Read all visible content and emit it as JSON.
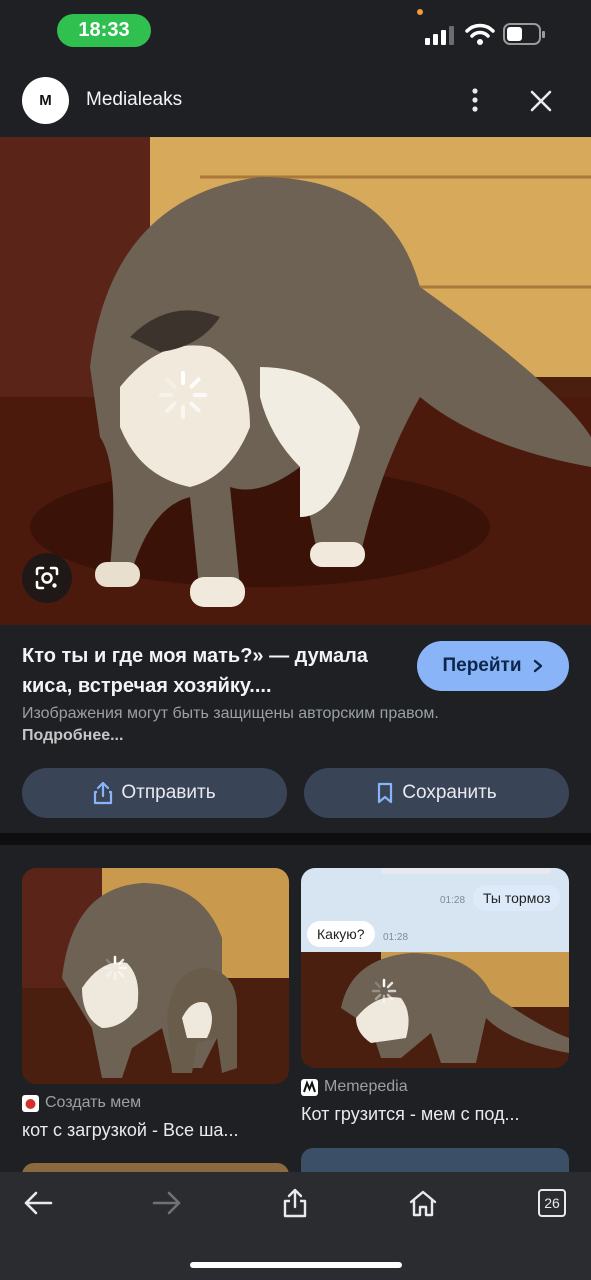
{
  "status": {
    "time": "18:33"
  },
  "header": {
    "logo_letter": "M",
    "site_name": "Medialeaks"
  },
  "result": {
    "title": "Кто ты и где моя мать?» — думала киса, встречая хозяйку....",
    "goto_label": "Перейти",
    "copyright_text": "Изображения могут быть защищены авторским правом.",
    "more_link": "Подробнее...",
    "share_label": "Отправить",
    "save_label": "Сохранить"
  },
  "related": [
    {
      "source": "Создать мем",
      "title": "кот с загрузкой - Все ша..."
    },
    {
      "source": "Memepedia",
      "title": "Кот грузится - мем с под..."
    }
  ],
  "chat": {
    "msg_right": "Ты тормоз",
    "time_right": "01:28",
    "msg_left": "Какую?",
    "time_left": "01:28"
  },
  "toolbar": {
    "tabs_count": "26"
  },
  "colors": {
    "accent": "#8ab4f8",
    "status_green": "#30c04f",
    "button_bg": "#394457"
  }
}
